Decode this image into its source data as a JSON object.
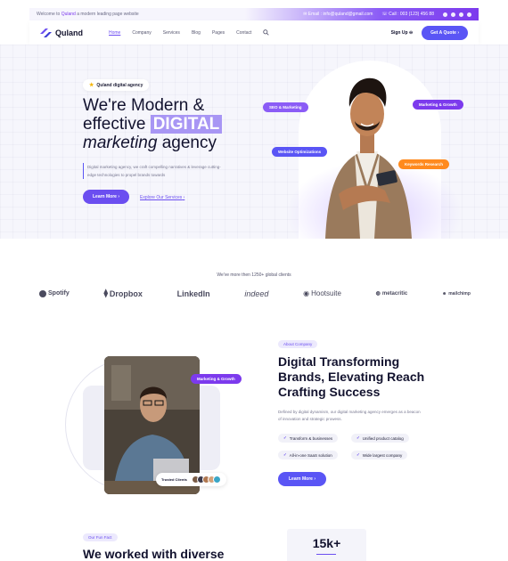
{
  "topbar": {
    "welcome_prefix": "Welcome to",
    "brand": "Quland",
    "welcome_suffix": "a modern leading page website",
    "email": "Email : info@quland@gmail.com",
    "phone": "Call : 003 (123) 456 88"
  },
  "nav": {
    "logo": "Quland",
    "items": [
      "Home",
      "Company",
      "Services",
      "Blog",
      "Pages",
      "Contact"
    ],
    "signup": "Sign Up",
    "cta": "Get A Quote"
  },
  "hero": {
    "badge": "Quland digital agency",
    "line1": "We're Modern &",
    "line2a": "effective",
    "line2b": "DIGITAL",
    "line3a": "marketing",
    "line3b": "agency",
    "paragraph": "Digital marketing agency, we craft compelling narratives & leverage cutting-edge technologies to propel brands towards",
    "learn": "Learn More",
    "explore": "Explore Our Services",
    "tags": {
      "seo": "SEO & Marketing",
      "growth": "Marketing & Growth",
      "web": "Website Optimizations",
      "keyword": "Keywords Research"
    }
  },
  "clients": {
    "title": "We've more then 1250+ global clients",
    "logos": [
      "Spotify",
      "Dropbox",
      "LinkedIn",
      "indeed",
      "Hootsuite",
      "metacritic",
      "mailchimp"
    ]
  },
  "about": {
    "tag": "About Company",
    "title1": "Digital Transforming",
    "title2": "Brands, Elevating Reach",
    "title3": "Crafting Success",
    "paragraph": "Defined by digital dynamism, our digital marketing agency emerges as a beacon of innovation and strategic prowess.",
    "features": [
      "Transform & businesses",
      "Unified product catalog",
      "All-in-one SaaS solution",
      "Wide largest company"
    ],
    "learn": "Learn More",
    "photo_tag": "Marketing & Growth",
    "trusted": "Trusted Clients"
  },
  "funfact": {
    "tag": "Our Fun Fact",
    "title": "We worked with diverse",
    "stat": "15k+"
  },
  "colors": {
    "accent": "#6b4ef0",
    "blue": "#5a55f5",
    "orange": "#ff8a1e",
    "purple": "#7c3aed"
  }
}
